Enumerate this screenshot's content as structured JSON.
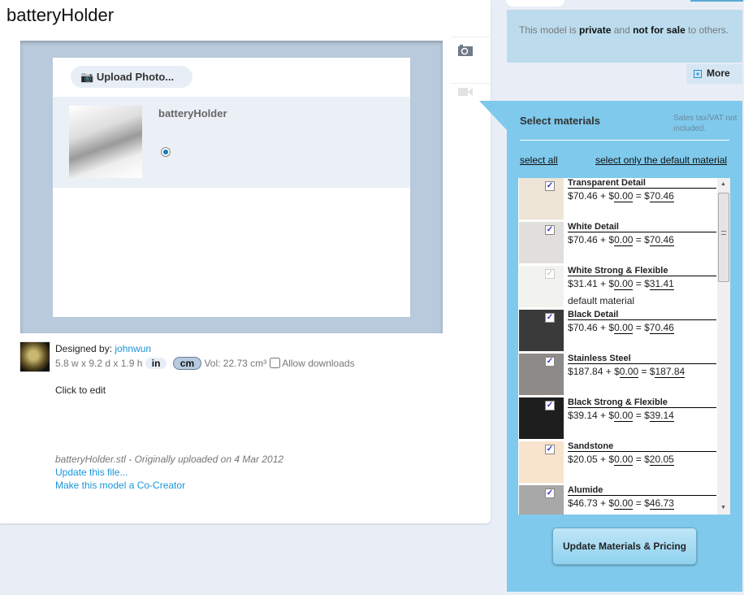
{
  "page": {
    "title": "batteryHolder"
  },
  "viewer": {
    "upload_label": "Upload Photo...",
    "model_name": "batteryHolder"
  },
  "details": {
    "designed_by_label": "Designed by:",
    "designer": "johnwun",
    "dimensions": "5.8 w x 9.2 d x 1.9 h",
    "unit_in": "in",
    "unit_cm": "cm",
    "selected_unit": "cm",
    "volume": "Vol: 22.73 cm³",
    "allow_downloads": "Allow downloads",
    "allow_downloads_checked": false,
    "click_to_edit": "Click to edit",
    "file_info": "batteryHolder.stl - Originally uploaded on 4 Mar 2012",
    "update_file": "Update this file...",
    "co_creator": "Make this model a Co-Creator"
  },
  "info": {
    "pre": "This model is ",
    "private": "private",
    "mid": " and ",
    "not_for_sale": "not for sale",
    "post": " to others.",
    "more": "More"
  },
  "materials": {
    "title": "Select materials",
    "tax_note": "Sales tax/VAT not included.",
    "select_all": "select all",
    "select_default": "select only the default material",
    "update_button": "Update Materials & Pricing",
    "items": [
      {
        "name": "Transparent Detail",
        "base": "70.46",
        "extra": "0.00",
        "total": "70.46",
        "checked": true,
        "color": "#eee5d6"
      },
      {
        "name": "White Detail",
        "base": "70.46",
        "extra": "0.00",
        "total": "70.46",
        "checked": true,
        "color": "#e0dfdb"
      },
      {
        "name": "White Strong & Flexible",
        "base": "31.41",
        "extra": "0.00",
        "total": "31.41",
        "checked": true,
        "disabled": true,
        "note": "default material",
        "color": "#f2f2ef"
      },
      {
        "name": "Black Detail",
        "base": "70.46",
        "extra": "0.00",
        "total": "70.46",
        "checked": true,
        "color": "#3a3a3a"
      },
      {
        "name": "Stainless Steel",
        "base": "187.84",
        "extra": "0.00",
        "total": "187.84",
        "checked": true,
        "color": "#8d8a87"
      },
      {
        "name": "Black Strong & Flexible",
        "base": "39.14",
        "extra": "0.00",
        "total": "39.14",
        "checked": true,
        "color": "#1e1e1e"
      },
      {
        "name": "Sandstone",
        "base": "20.05",
        "extra": "0.00",
        "total": "20.05",
        "checked": true,
        "color": "#f8e3cc"
      },
      {
        "name": "Alumide",
        "base": "46.73",
        "extra": "0.00",
        "total": "46.73",
        "checked": true,
        "color": "#a8a8a8"
      }
    ]
  }
}
